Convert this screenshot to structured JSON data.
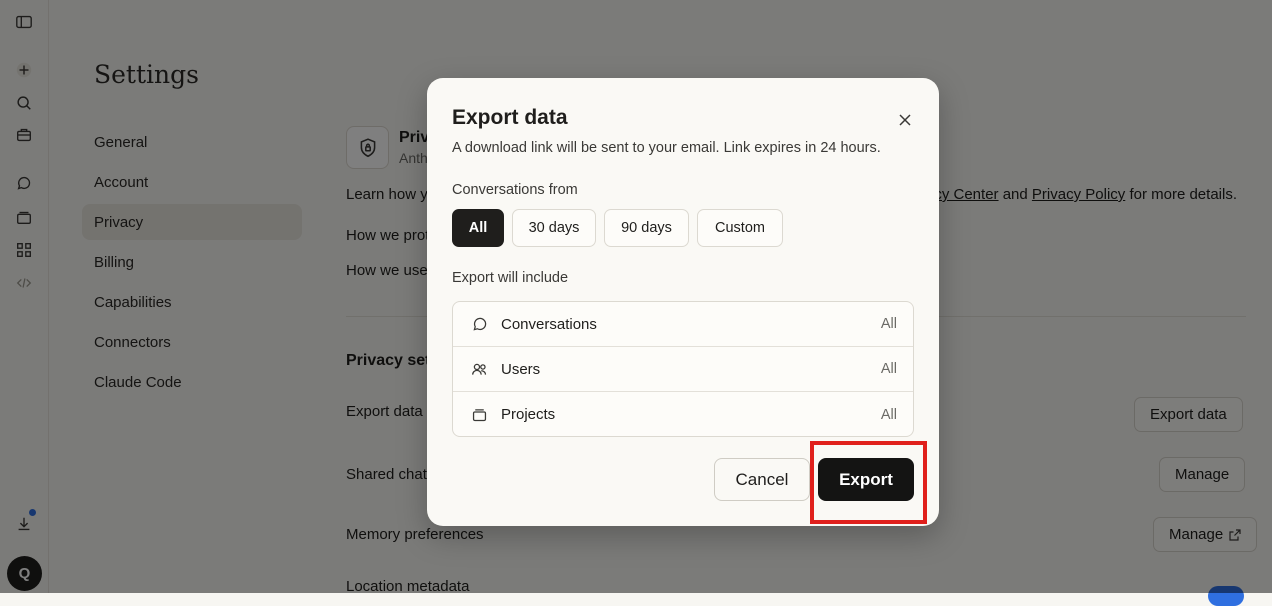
{
  "settings": {
    "title": "Settings",
    "nav": [
      "General",
      "Account",
      "Privacy",
      "Billing",
      "Capabilities",
      "Connectors",
      "Claude Code"
    ],
    "active": "Privacy"
  },
  "user": {
    "initial": "Q"
  },
  "main": {
    "privacy_title": "Priv",
    "privacy_sub": "Anth",
    "learn_left": "Learn how yo",
    "learn_link1": "acy Center",
    "learn_and": "and",
    "learn_link2": "Privacy Policy",
    "learn_tail": "for more details.",
    "how_protect": "How we prot",
    "how_use": "How we use",
    "section_title": "Privacy set",
    "rows": {
      "export_data": "Export data",
      "shared_chats": "Shared chat",
      "memory": "Memory preferences",
      "location": "Location metadata"
    },
    "buttons": {
      "export_data": "Export data",
      "manage1": "Manage",
      "manage2": "Manage"
    }
  },
  "modal": {
    "title": "Export data",
    "subtitle": "A download link will be sent to your email. Link expires in 24 hours.",
    "range_label": "Conversations from",
    "ranges": [
      "All",
      "30 days",
      "90 days",
      "Custom"
    ],
    "selected_range": "All",
    "include_label": "Export will include",
    "include": [
      {
        "name": "Conversations",
        "value": "All",
        "icon": "chat-bubble-icon"
      },
      {
        "name": "Users",
        "value": "All",
        "icon": "users-icon"
      },
      {
        "name": "Projects",
        "value": "All",
        "icon": "projects-icon"
      }
    ],
    "cancel": "Cancel",
    "export": "Export"
  },
  "colors": {
    "accent": "#141413",
    "highlight": "#e0201c",
    "notification_dot": "#2f6fe0"
  }
}
